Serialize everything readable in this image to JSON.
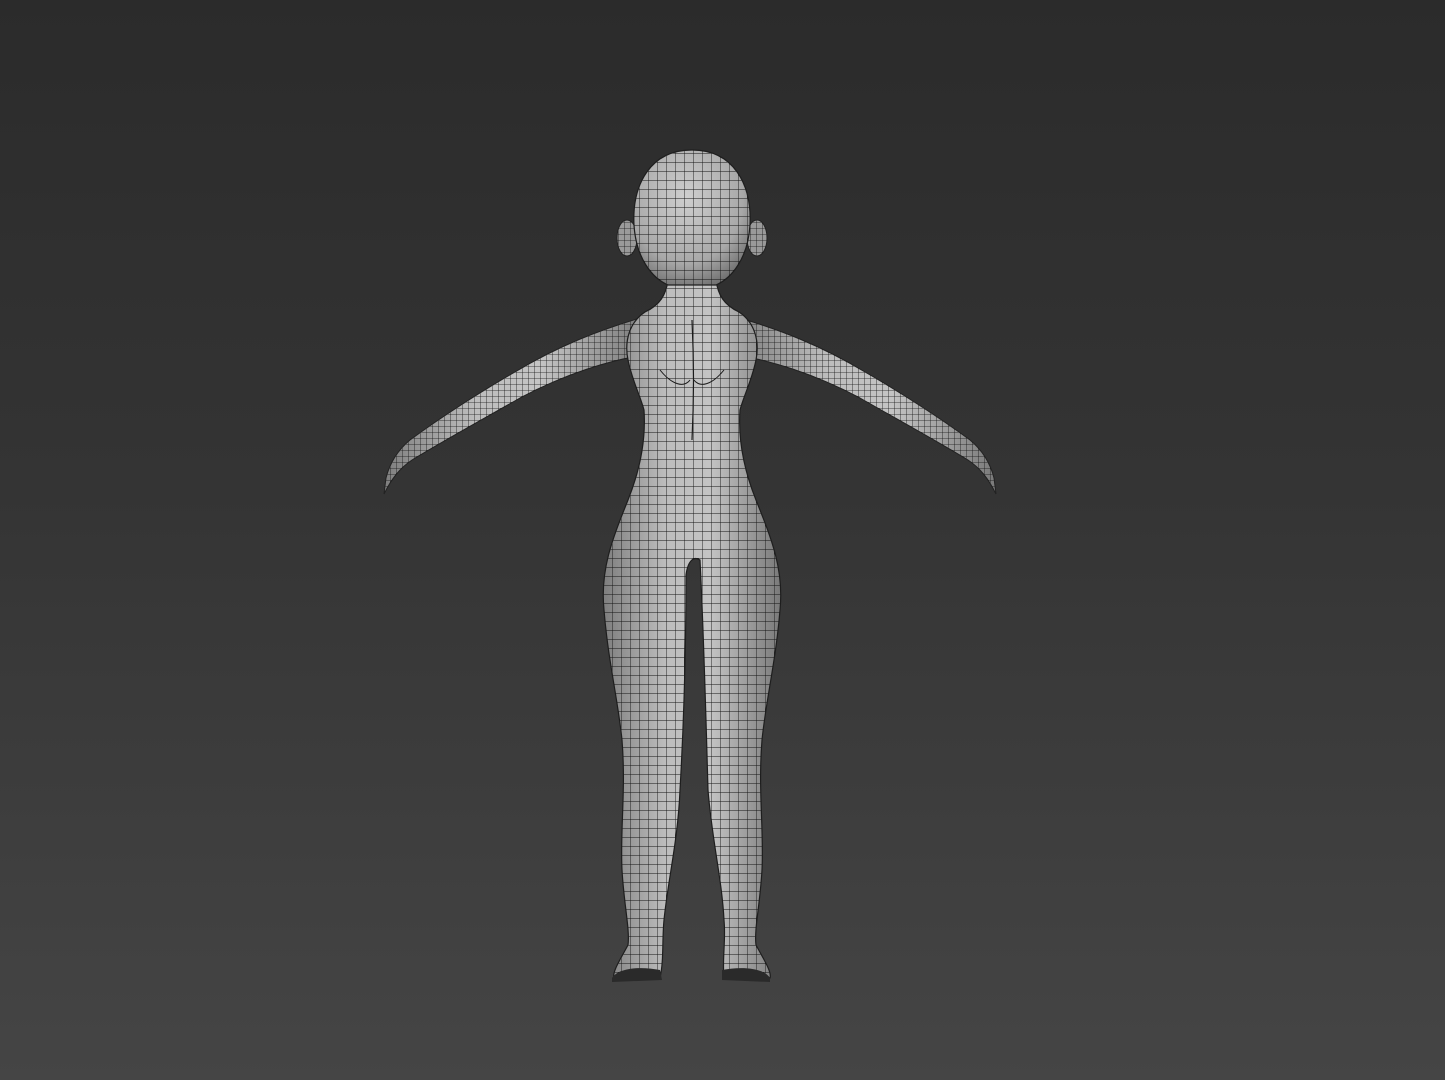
{
  "viewport": {
    "background_top": "#2b2b2b",
    "background_bottom": "#454545"
  },
  "model": {
    "subject": "cartoon-female-base-mesh",
    "view": "back",
    "pose": "a-pose",
    "display": "wireframe-on-shaded",
    "surface_color": "#a9a9a9",
    "wire_color": "#111111"
  }
}
